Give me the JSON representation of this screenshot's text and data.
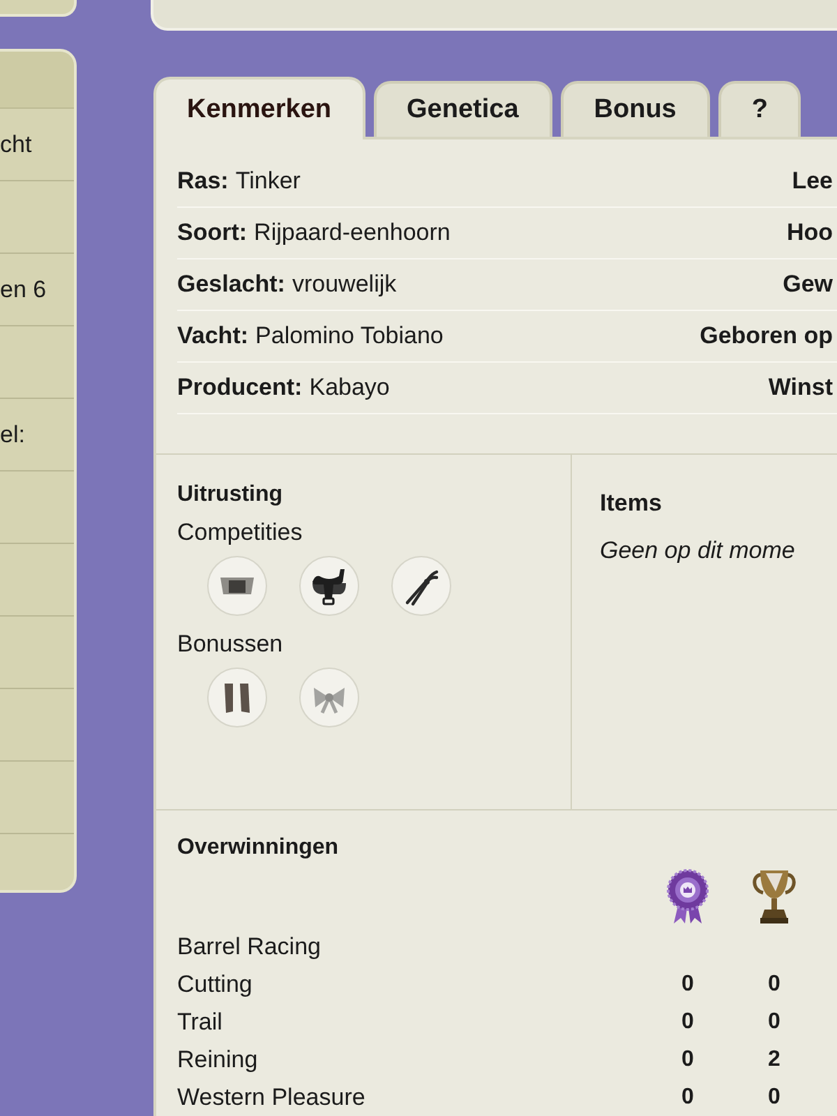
{
  "sidebar": {
    "rows": [
      {
        "label": "cht"
      },
      {
        "label": "en 6"
      },
      {
        "label": "el:"
      }
    ]
  },
  "tabs": [
    {
      "label": "Kenmerken",
      "selected": true
    },
    {
      "label": "Genetica",
      "selected": false
    },
    {
      "label": "Bonus",
      "selected": false
    },
    {
      "label": "?",
      "selected": false
    }
  ],
  "traits": [
    {
      "label": "Ras:",
      "value": "Tinker",
      "side_label": "Lee"
    },
    {
      "label": "Soort:",
      "value": "Rijpaard-eenhoorn",
      "side_label": "Hoo"
    },
    {
      "label": "Geslacht:",
      "value": "vrouwelijk",
      "side_label": "Gew"
    },
    {
      "label": "Vacht:",
      "value": "Palomino Tobiano",
      "side_label": "Geboren op"
    },
    {
      "label": "Producent:",
      "value": "Kabayo",
      "side_label": "Winst"
    }
  ],
  "equipment": {
    "title": "Uitrusting",
    "groups": [
      {
        "title": "Competities",
        "items": [
          {
            "kind": "pad"
          },
          {
            "kind": "saddle"
          },
          {
            "kind": "pliers"
          }
        ]
      },
      {
        "title": "Bonussen",
        "items": [
          {
            "kind": "boots"
          },
          {
            "kind": "bow"
          }
        ]
      }
    ]
  },
  "items": {
    "title": "Items",
    "empty_text": "Geen op dit mome"
  },
  "victories": {
    "title": "Overwinningen",
    "columns": [
      {
        "kind": "rosette"
      },
      {
        "kind": "trophy"
      }
    ],
    "rows": [
      {
        "discipline": "Barrel Racing"
      },
      {
        "discipline": "Cutting",
        "counts": [
          "0",
          "0"
        ]
      },
      {
        "discipline": "Trail",
        "counts": [
          "0",
          "0"
        ]
      },
      {
        "discipline": "Reining",
        "counts": [
          "0",
          "2"
        ]
      },
      {
        "discipline": "Western Pleasure",
        "counts": [
          "0",
          "0"
        ]
      }
    ]
  }
}
